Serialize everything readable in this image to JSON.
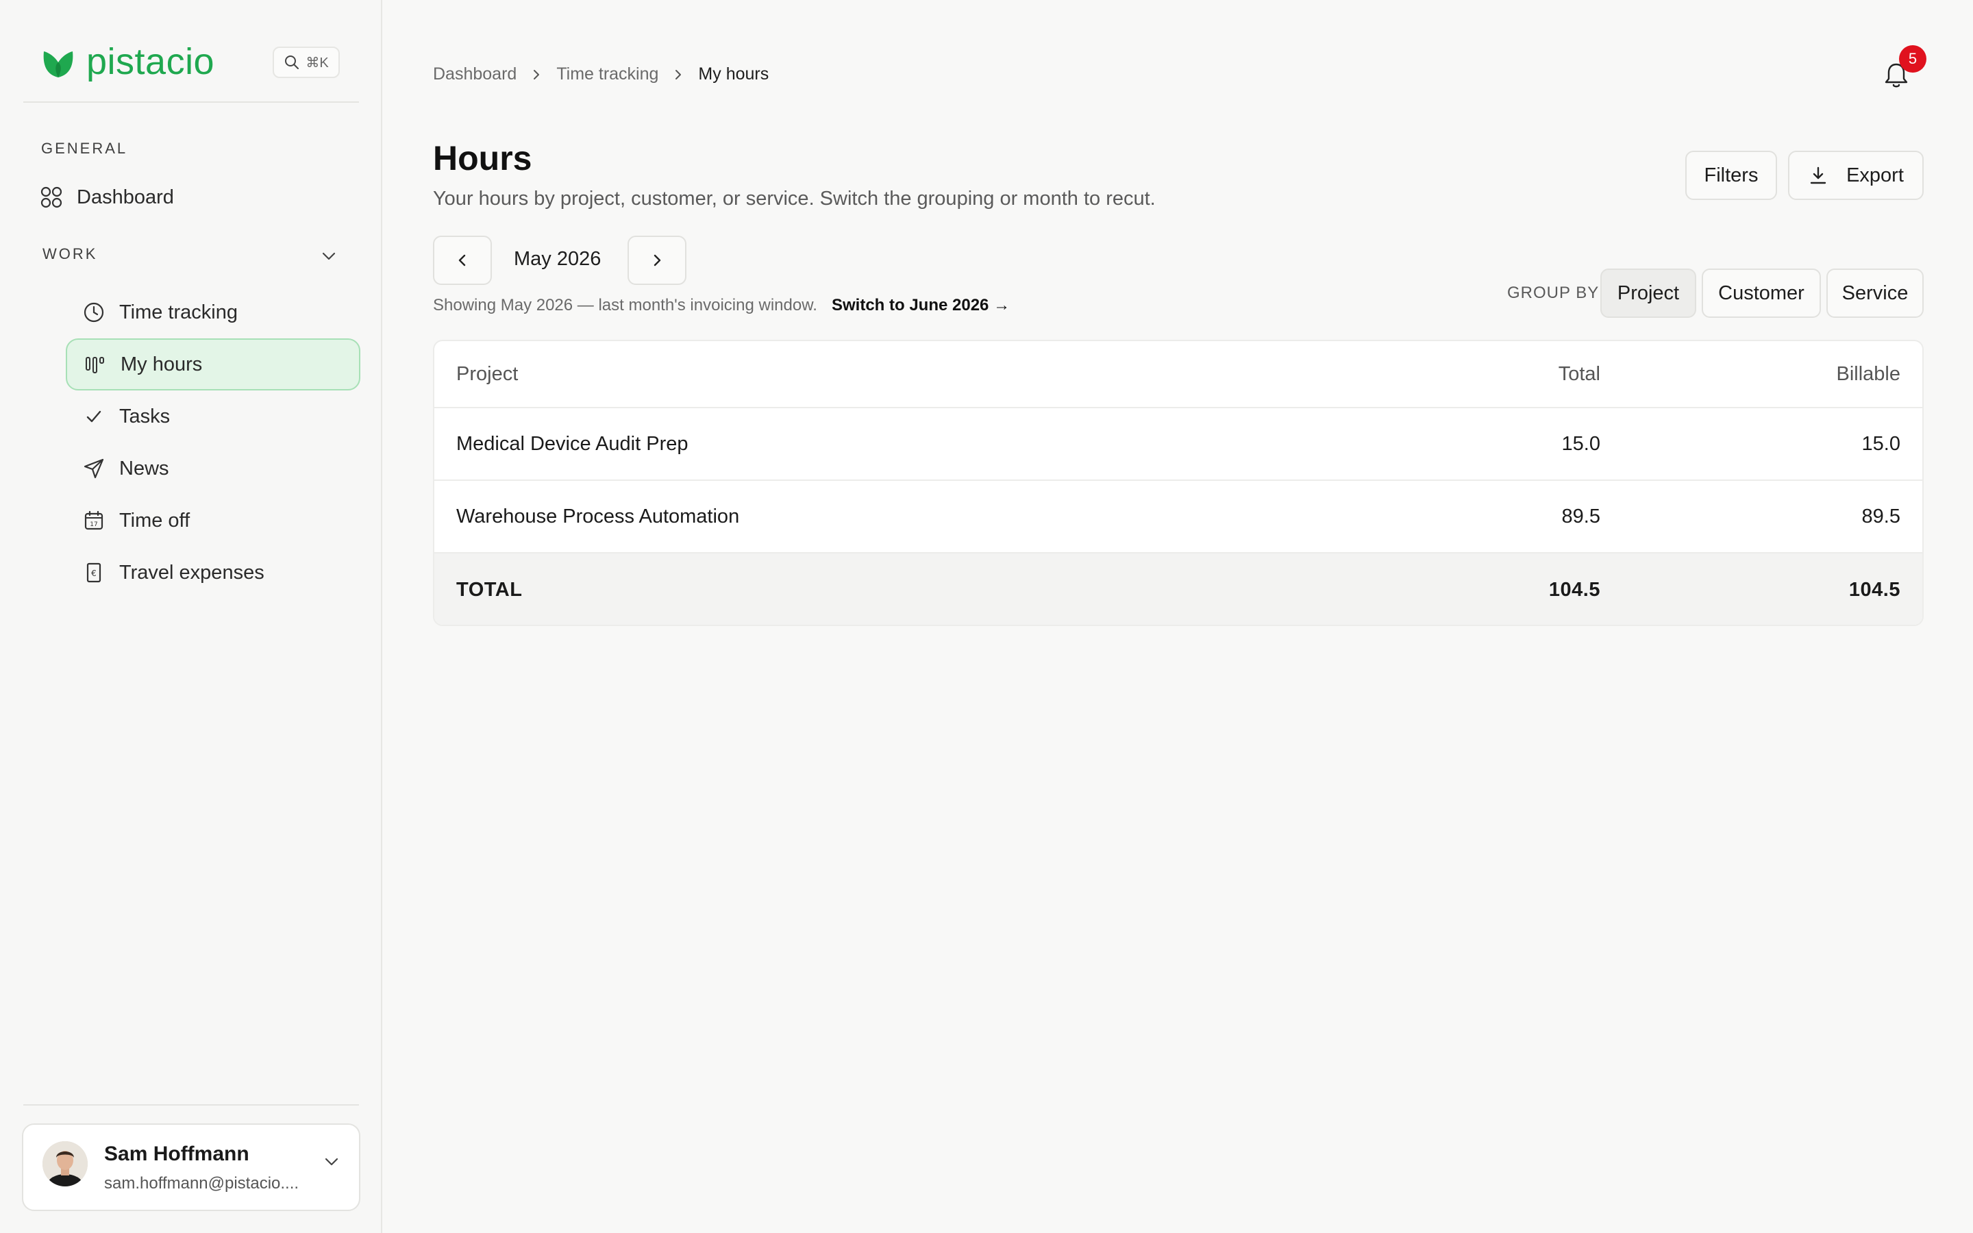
{
  "app": {
    "name": "pistacio",
    "search_shortcut": "⌘K",
    "accent_color": "#1fa84f"
  },
  "sidebar": {
    "sections": [
      {
        "label": "GENERAL",
        "items": [
          {
            "label": "Dashboard",
            "icon": "grid-icon"
          }
        ]
      },
      {
        "label": "WORK",
        "items": [
          {
            "label": "Time tracking",
            "icon": "clock-icon"
          },
          {
            "label": "My hours",
            "icon": "bars-icon",
            "active": true
          },
          {
            "label": "Tasks",
            "icon": "check-icon"
          },
          {
            "label": "News",
            "icon": "send-icon"
          },
          {
            "label": "Time off",
            "icon": "calendar-icon"
          },
          {
            "label": "Travel expenses",
            "icon": "receipt-icon"
          }
        ]
      }
    ],
    "user": {
      "name": "Sam Hoffmann",
      "email": "sam.hoffmann@pistacio...."
    }
  },
  "header": {
    "breadcrumb": [
      "Dashboard",
      "Time tracking",
      "My hours"
    ],
    "notifications_count": "5"
  },
  "page": {
    "title": "Hours",
    "subtitle": "Your hours by project, customer, or service. Switch the grouping or month to recut.",
    "filters_label": "Filters",
    "export_label": "Export",
    "month": "May 2026",
    "info": "Showing May 2026 — last month's invoicing window.",
    "switch_link": "Switch to June 2026 →",
    "group_by_label": "GROUP BY",
    "group_by_options": [
      "Project",
      "Customer",
      "Service"
    ],
    "group_by_selected": "Project"
  },
  "table": {
    "columns": [
      "Project",
      "Total",
      "Billable"
    ],
    "rows": [
      {
        "name": "Medical Device Audit Prep",
        "total": "15.0",
        "billable": "15.0"
      },
      {
        "name": "Warehouse Process Automation",
        "total": "89.5",
        "billable": "89.5"
      }
    ],
    "total_row": {
      "name": "TOTAL",
      "total": "104.5",
      "billable": "104.5"
    }
  }
}
